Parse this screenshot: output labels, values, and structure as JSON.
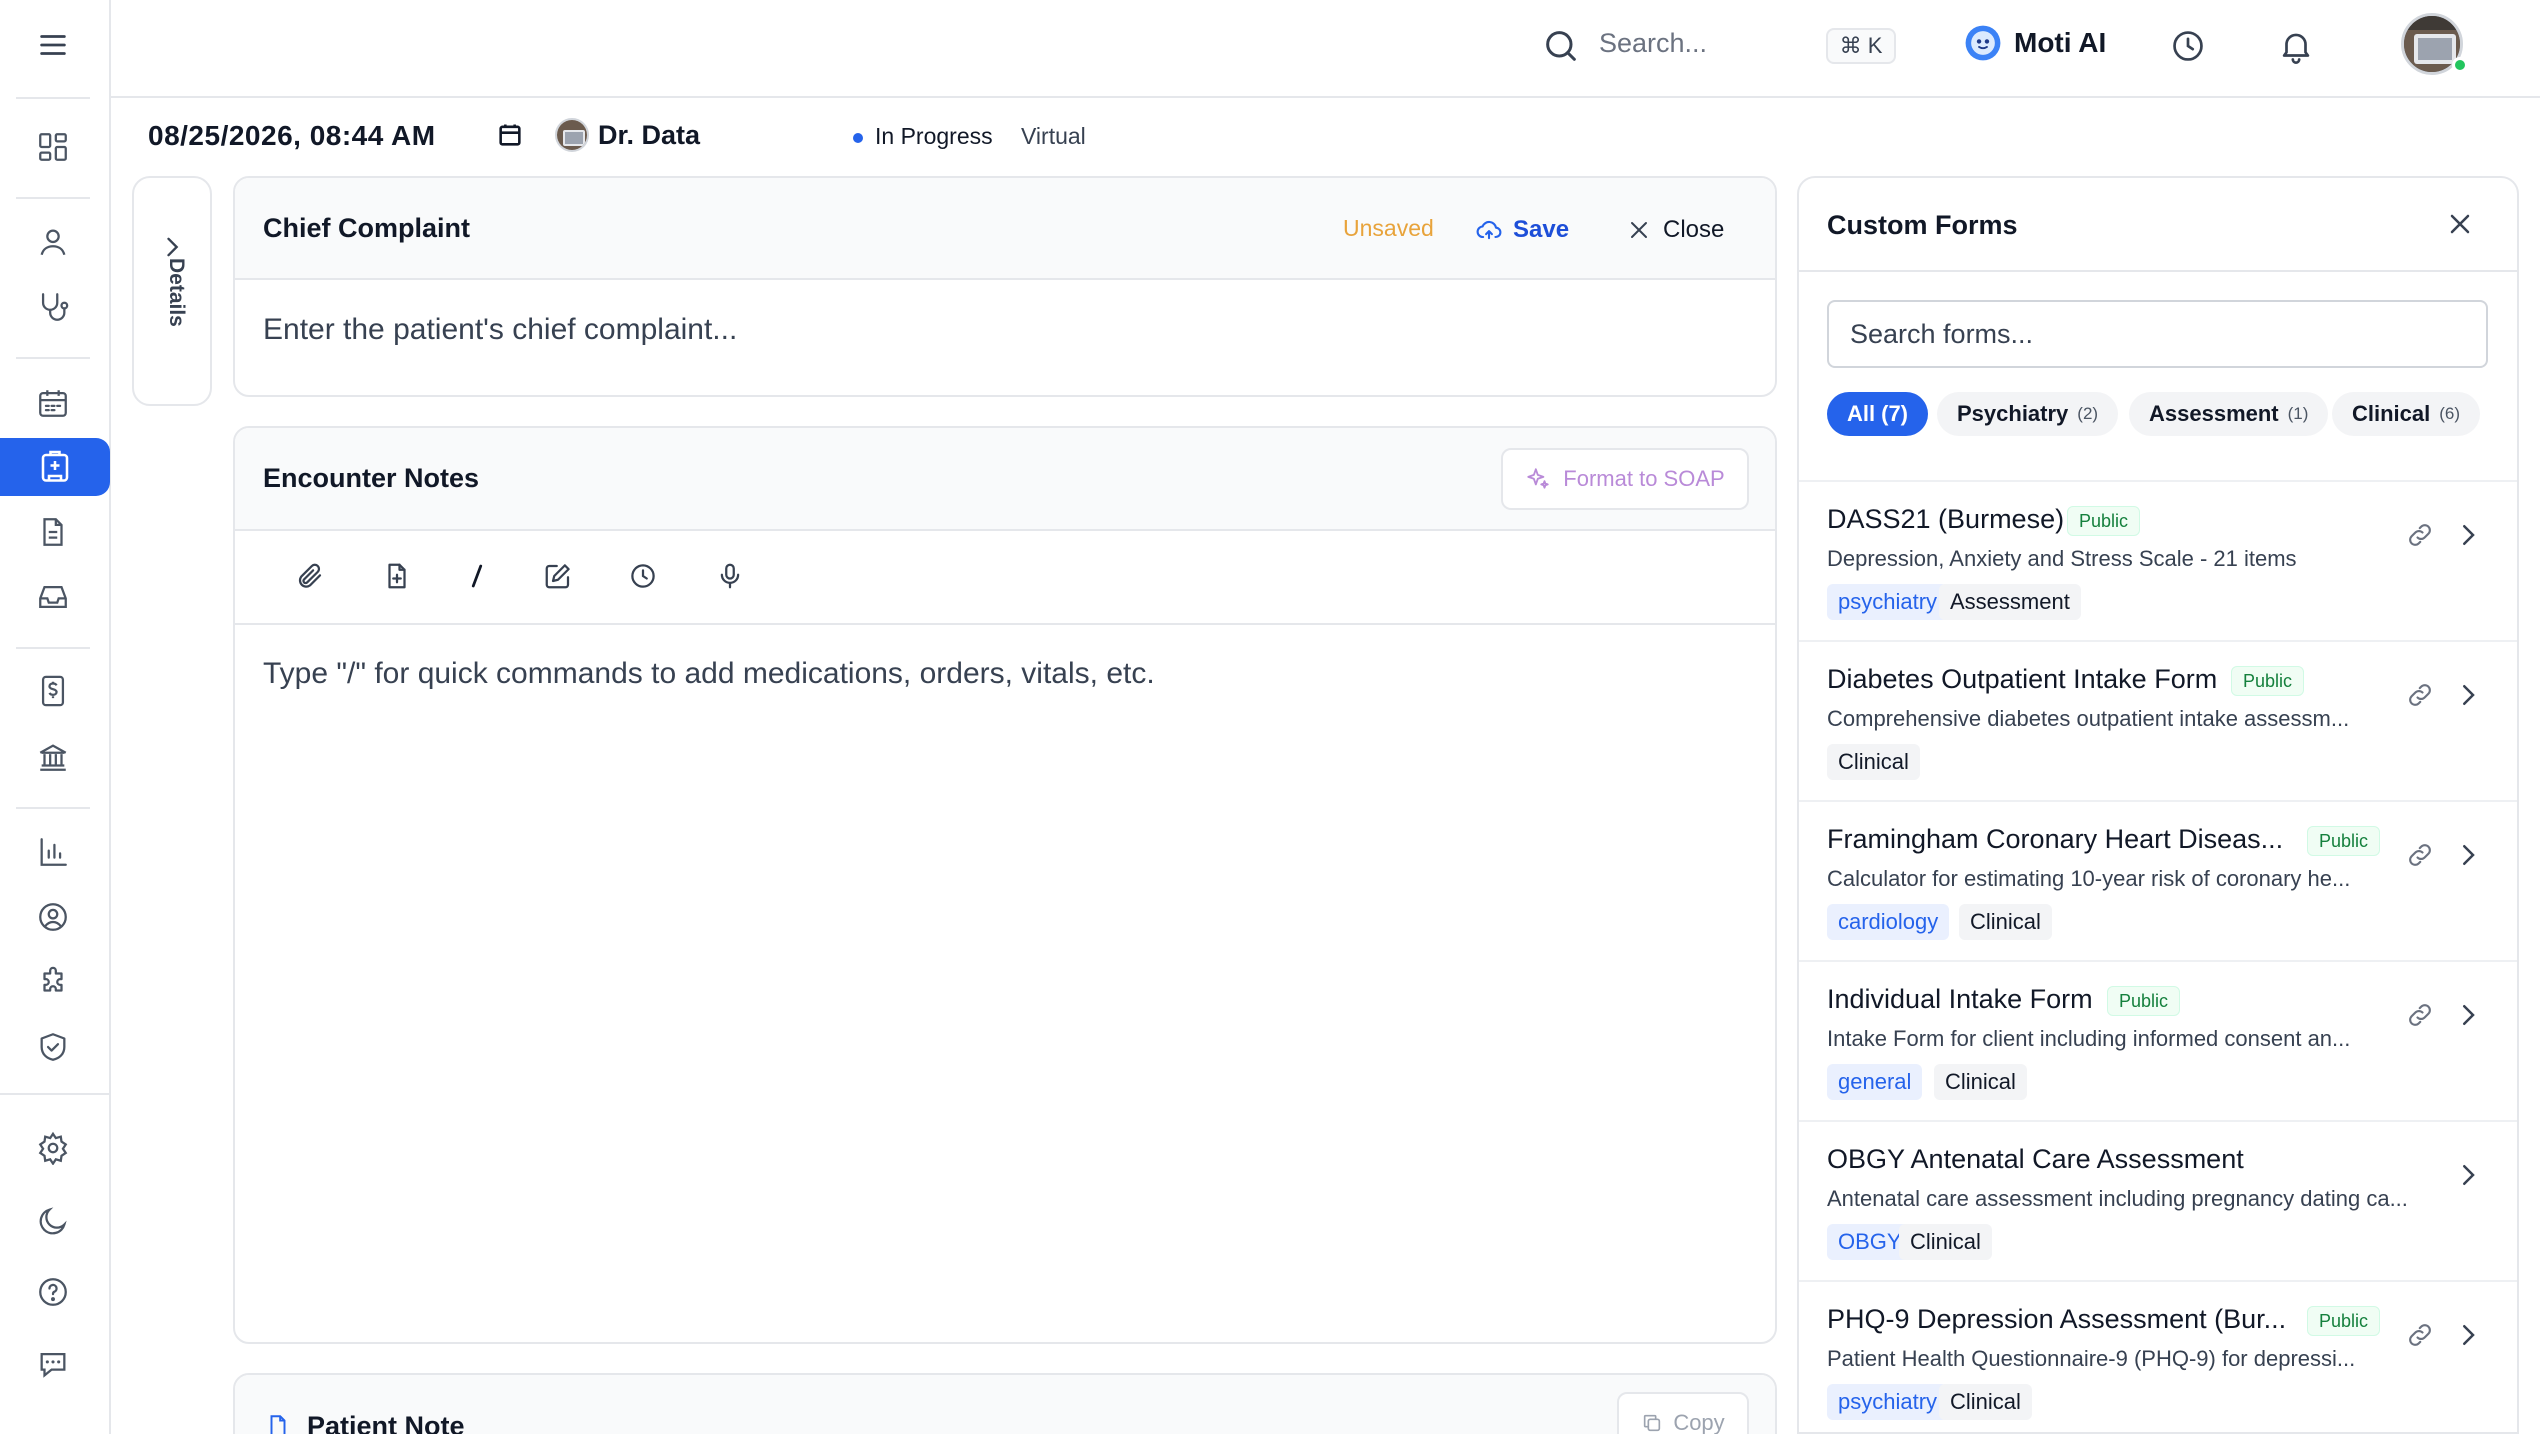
{
  "topbar": {
    "search_placeholder": "Search...",
    "shortcut": "⌘ K",
    "assistant_label": "Moti AI"
  },
  "encounter": {
    "datetime": "08/25/2026, 08:44 AM",
    "provider": "Dr. Data",
    "status": "In Progress",
    "visit_type": "Virtual",
    "details_tab": "Details"
  },
  "chief_complaint": {
    "title": "Chief Complaint",
    "unsaved_label": "Unsaved",
    "save_label": "Save",
    "close_label": "Close",
    "placeholder": "Enter the patient's chief complaint..."
  },
  "encounter_notes": {
    "title": "Encounter Notes",
    "format_label": "Format to SOAP",
    "placeholder": "Type \"/\" for quick commands to add medications, orders, vitals, etc."
  },
  "patient_note": {
    "title": "Patient Note",
    "copy_label": "Copy"
  },
  "custom_forms": {
    "title": "Custom Forms",
    "search_placeholder": "Search forms...",
    "filters": [
      {
        "label": "All",
        "count": "(7)"
      },
      {
        "label": "Psychiatry",
        "count": "(2)"
      },
      {
        "label": "Assessment",
        "count": "(1)"
      },
      {
        "label": "Clinical",
        "count": "(6)"
      }
    ],
    "public_label": "Public",
    "forms": [
      {
        "title": "DASS21 (Burmese)",
        "desc": "Depression, Anxiety and Stress Scale - 21 items",
        "tags": [
          "psychiatry",
          "Assessment"
        ]
      },
      {
        "title": "Diabetes Outpatient Intake Form",
        "desc": "Comprehensive diabetes outpatient intake assessm...",
        "tags": [
          "Clinical"
        ]
      },
      {
        "title": "Framingham Coronary Heart Diseas...",
        "desc": "Calculator for estimating 10-year risk of coronary he...",
        "tags": [
          "cardiology",
          "Clinical"
        ]
      },
      {
        "title": "Individual Intake Form",
        "desc": "Intake Form for client including informed consent an...",
        "tags": [
          "general",
          "Clinical"
        ]
      },
      {
        "title": "OBGY Antenatal Care Assessment",
        "desc": "Antenatal care assessment including pregnancy dating ca...",
        "tags": [
          "OBGY",
          "Clinical"
        ]
      },
      {
        "title": "PHQ-9 Depression Assessment (Bur...",
        "desc": "Patient Health Questionnaire-9 (PHQ-9) for depressi...",
        "tags": [
          "psychiatry",
          "Clinical"
        ]
      }
    ]
  },
  "colors": {
    "accent": "#2563eb",
    "unsaved": "#e8a33b",
    "soap": "#b98ad8",
    "public_green": "#15803d",
    "online_dot": "#22c55e"
  }
}
